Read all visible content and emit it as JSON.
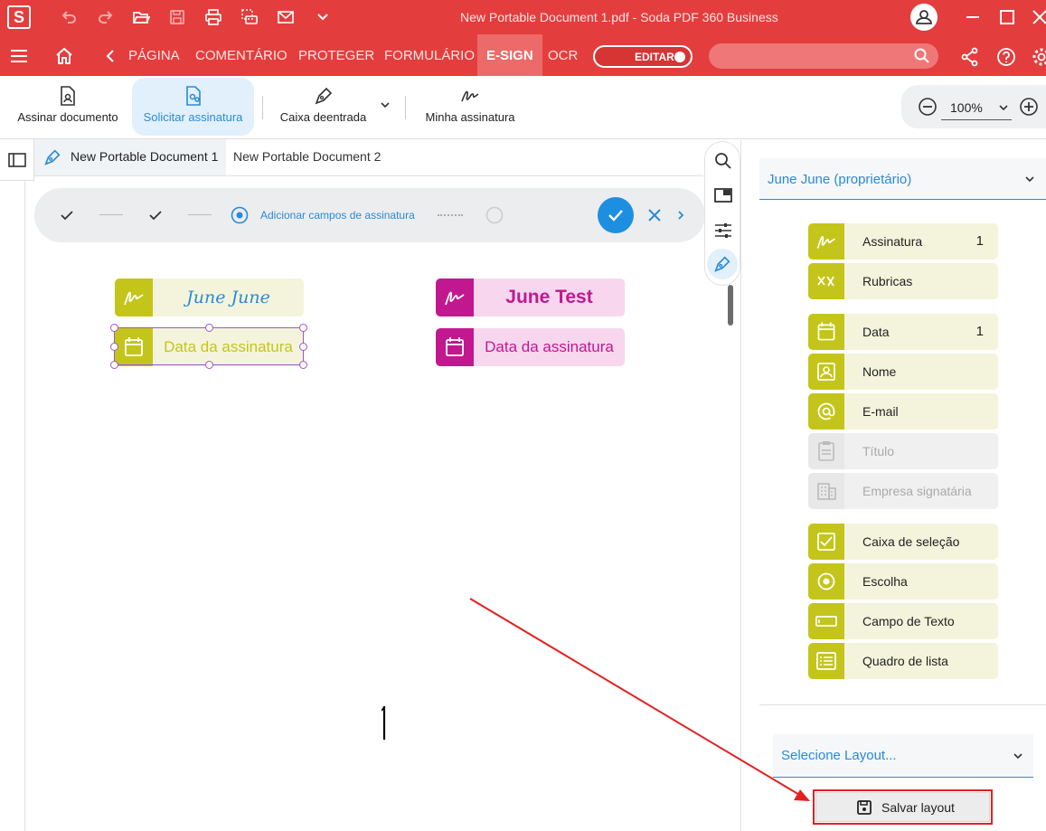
{
  "app": {
    "logo": "S",
    "title": "New Portable Document 1.pdf  -  Soda PDF 360 Business",
    "colors": {
      "brand": "#e43d3d",
      "accent": "#2a8bd6",
      "field_green": "#c4c51a",
      "field_magenta": "#c2188f"
    }
  },
  "quick_access_icons": [
    "undo-icon",
    "redo-icon",
    "open-folder-icon",
    "save-icon",
    "print-icon",
    "scan-icon",
    "mail-icon",
    "chevron-down-icon"
  ],
  "ribbon": {
    "tabs": [
      "PÁGINA",
      "COMENTÁRIO",
      "PROTEGER",
      "FORMULÁRIO",
      "E-SIGN",
      "OCR"
    ],
    "active_tab": "E-SIGN",
    "edit_toggle": "EDITAR"
  },
  "toolbar": {
    "sign_document": "Assinar documento",
    "request_signature": "Solicitar assinatura",
    "input_box": "Caixa deentrada",
    "my_signature": "Minha assinatura",
    "zoom": "100%"
  },
  "doc_tabs": [
    "New Portable Document 1",
    "New Portable Document 2"
  ],
  "progress": {
    "current_step": "Adicionar campos de assinatura"
  },
  "fields": {
    "sig1": "June June",
    "date1": "Data da assinatura",
    "sig2": "June Test",
    "date2": "Data da assinatura"
  },
  "panel": {
    "owner": "June June (proprietário)",
    "items": [
      {
        "label": "Assinatura",
        "count": "1",
        "icon": "signature-icon"
      },
      {
        "label": "Rubricas",
        "count": "",
        "icon": "initials-icon"
      },
      {
        "label": "Data",
        "count": "1",
        "icon": "calendar-icon"
      },
      {
        "label": "Nome",
        "count": "",
        "icon": "id-card-icon"
      },
      {
        "label": "E-mail",
        "count": "",
        "icon": "at-icon"
      },
      {
        "label": "Título",
        "count": "",
        "icon": "clipboard-icon"
      },
      {
        "label": "Empresa signatária",
        "count": "",
        "icon": "building-icon"
      },
      {
        "label": "Caixa de seleção",
        "count": "",
        "icon": "checkbox-icon"
      },
      {
        "label": "Escolha",
        "count": "",
        "icon": "radio-icon"
      },
      {
        "label": "Campo de Texto",
        "count": "",
        "icon": "text-field-icon"
      },
      {
        "label": "Quadro de lista",
        "count": "",
        "icon": "list-icon"
      }
    ],
    "layout_placeholder": "Selecione Layout...",
    "save_layout": "Salvar layout"
  }
}
